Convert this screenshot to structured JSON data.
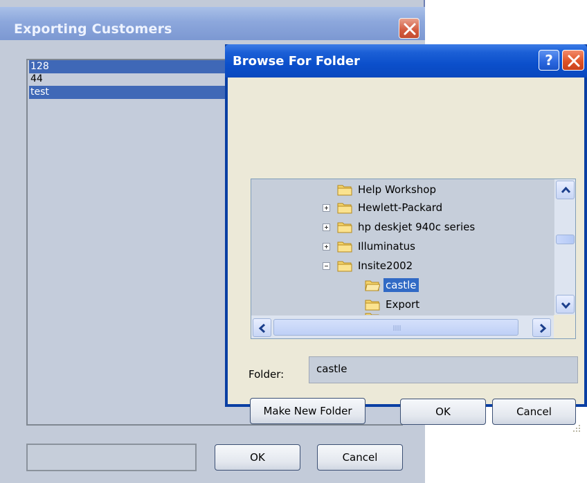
{
  "background_dialog": {
    "title": "Exporting Customers",
    "list_items": [
      {
        "label": "128",
        "selected": true
      },
      {
        "label": "44",
        "selected": false
      },
      {
        "label": "test",
        "selected": true
      }
    ],
    "status_value": "",
    "ok_label": "OK",
    "cancel_label": "Cancel"
  },
  "browse_dialog": {
    "title": "Browse For Folder",
    "help_label": "?",
    "tree": {
      "items": [
        {
          "label": "Help Workshop",
          "expander": "none",
          "selected": false
        },
        {
          "label": "Hewlett-Packard",
          "expander": "plus",
          "selected": false
        },
        {
          "label": "hp deskjet 940c series",
          "expander": "plus",
          "selected": false
        },
        {
          "label": "Illuminatus",
          "expander": "plus",
          "selected": false
        },
        {
          "label": "Insite2002",
          "expander": "minus",
          "selected": false
        },
        {
          "label": "castle",
          "expander": "none",
          "selected": true
        },
        {
          "label": "Export",
          "expander": "none",
          "selected": false
        }
      ]
    },
    "folder_label": "Folder:",
    "folder_value": "castle",
    "make_new_folder_label": "Make New Folder",
    "ok_label": "OK",
    "cancel_label": "Cancel"
  },
  "colors": {
    "selection": "#316ac5",
    "titlebar_active": "#0a48be",
    "titlebar_inactive": "#8ca7dc",
    "dialog_face": "#ece9d8"
  }
}
